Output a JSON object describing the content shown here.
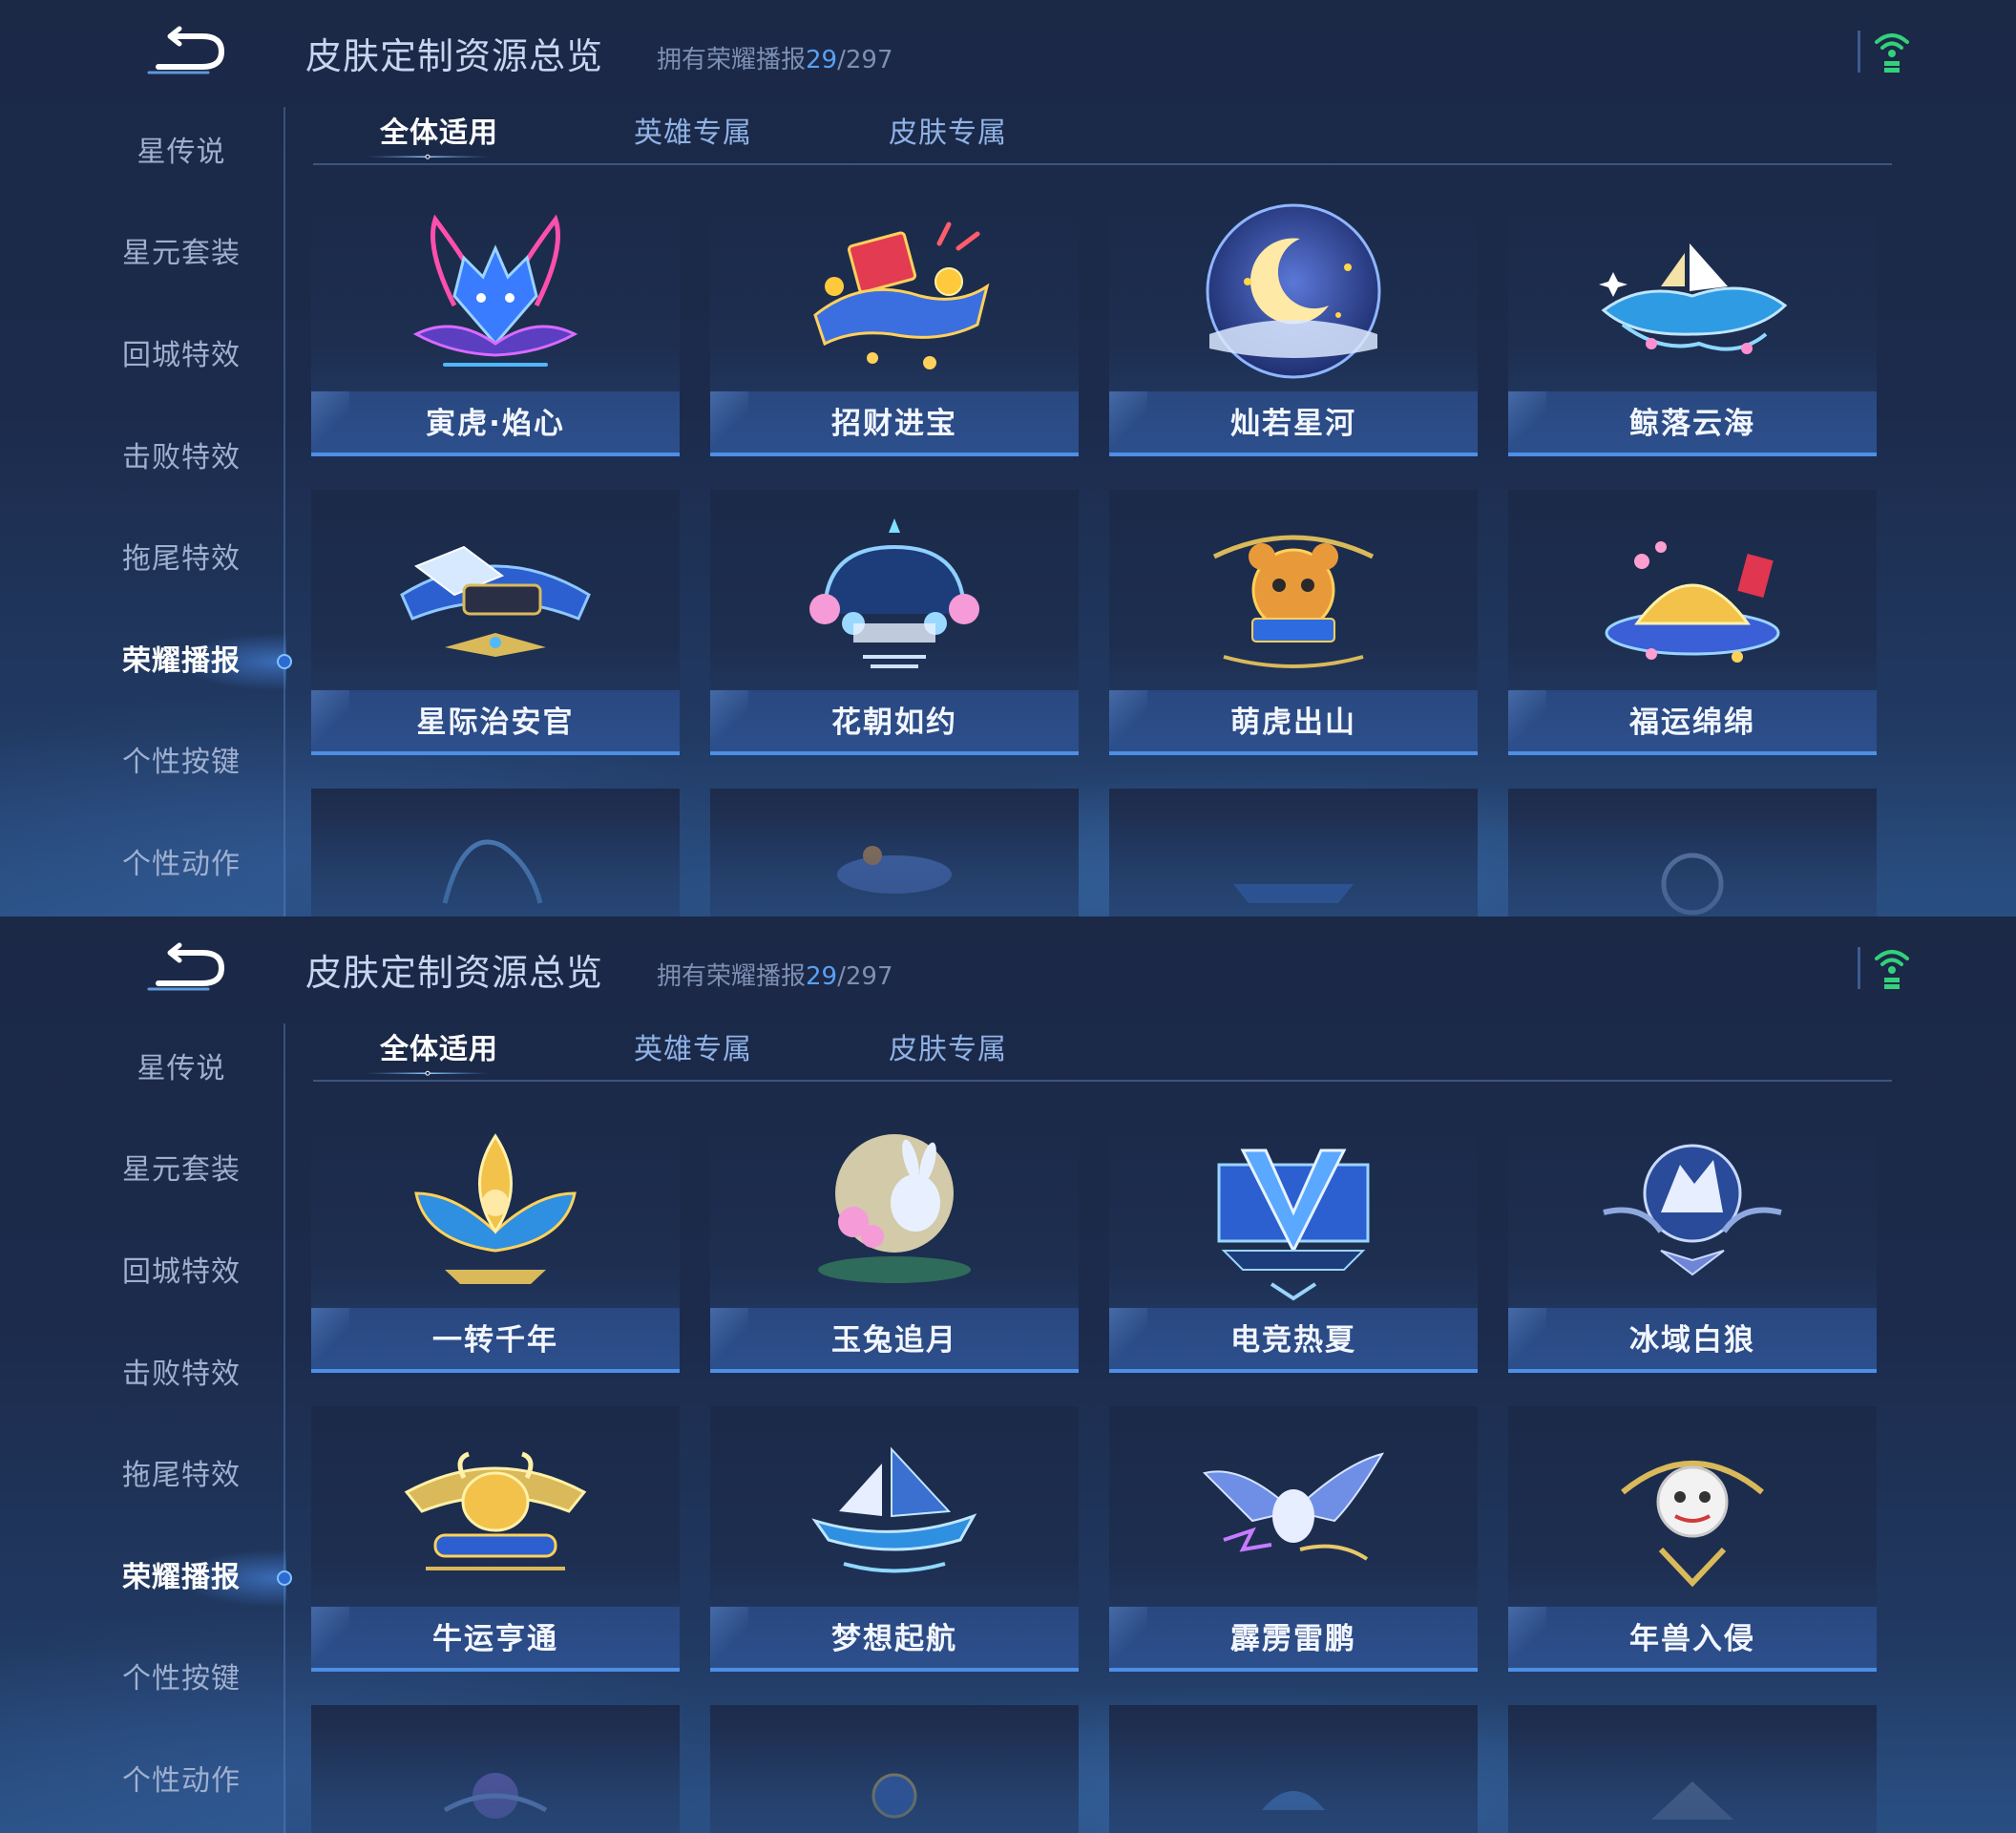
{
  "screens": [
    {
      "header": {
        "title": "皮肤定制资源总览",
        "owned_prefix": "拥有荣耀播报",
        "owned_count": "29",
        "owned_total": "/297"
      },
      "sidebar": [
        {
          "label": "星传说",
          "active": false
        },
        {
          "label": "星元套装",
          "active": false
        },
        {
          "label": "回城特效",
          "active": false
        },
        {
          "label": "击败特效",
          "active": false
        },
        {
          "label": "拖尾特效",
          "active": false
        },
        {
          "label": "荣耀播报",
          "active": true
        },
        {
          "label": "个性按键",
          "active": false
        },
        {
          "label": "个性动作",
          "active": false
        }
      ],
      "tabs": [
        {
          "label": "全体适用",
          "active": true
        },
        {
          "label": "英雄专属",
          "active": false
        },
        {
          "label": "皮肤专属",
          "active": false
        }
      ],
      "cards": [
        {
          "label": "寅虎·焰心",
          "icon": "tiger-flame-icon"
        },
        {
          "label": "招财进宝",
          "icon": "fortune-treasure-icon"
        },
        {
          "label": "灿若星河",
          "icon": "crescent-moon-icon"
        },
        {
          "label": "鲸落云海",
          "icon": "whale-sailboat-icon"
        },
        {
          "label": "星际治安官",
          "icon": "space-sheriff-icon"
        },
        {
          "label": "花朝如约",
          "icon": "flower-arch-icon"
        },
        {
          "label": "萌虎出山",
          "icon": "cute-tiger-icon"
        },
        {
          "label": "福运绵绵",
          "icon": "lucky-treasure-icon"
        }
      ]
    },
    {
      "header": {
        "title": "皮肤定制资源总览",
        "owned_prefix": "拥有荣耀播报",
        "owned_count": "29",
        "owned_total": "/297"
      },
      "sidebar": [
        {
          "label": "星传说",
          "active": false
        },
        {
          "label": "星元套装",
          "active": false
        },
        {
          "label": "回城特效",
          "active": false
        },
        {
          "label": "击败特效",
          "active": false
        },
        {
          "label": "拖尾特效",
          "active": false
        },
        {
          "label": "荣耀播报",
          "active": true
        },
        {
          "label": "个性按键",
          "active": false
        },
        {
          "label": "个性动作",
          "active": false
        }
      ],
      "tabs": [
        {
          "label": "全体适用",
          "active": true
        },
        {
          "label": "英雄专属",
          "active": false
        },
        {
          "label": "皮肤专属",
          "active": false
        }
      ],
      "cards": [
        {
          "label": "一转千年",
          "icon": "golden-lotus-icon"
        },
        {
          "label": "玉兔追月",
          "icon": "jade-rabbit-icon"
        },
        {
          "label": "电竞热夏",
          "icon": "esports-v-icon"
        },
        {
          "label": "冰域白狼",
          "icon": "ice-wolf-icon"
        },
        {
          "label": "牛运亨通",
          "icon": "golden-ox-icon"
        },
        {
          "label": "梦想起航",
          "icon": "sailing-ship-icon"
        },
        {
          "label": "霹雳雷鹏",
          "icon": "thunder-eagle-icon"
        },
        {
          "label": "年兽入侵",
          "icon": "nian-beast-icon"
        }
      ]
    }
  ],
  "colors": {
    "accent": "#4e8fe6",
    "active_text": "#ffffff",
    "inactive_text": "#9fb0cf",
    "tab_text": "#8fb2e6",
    "owned_count": "#5aa0f2",
    "wifi": "#33d17a"
  }
}
